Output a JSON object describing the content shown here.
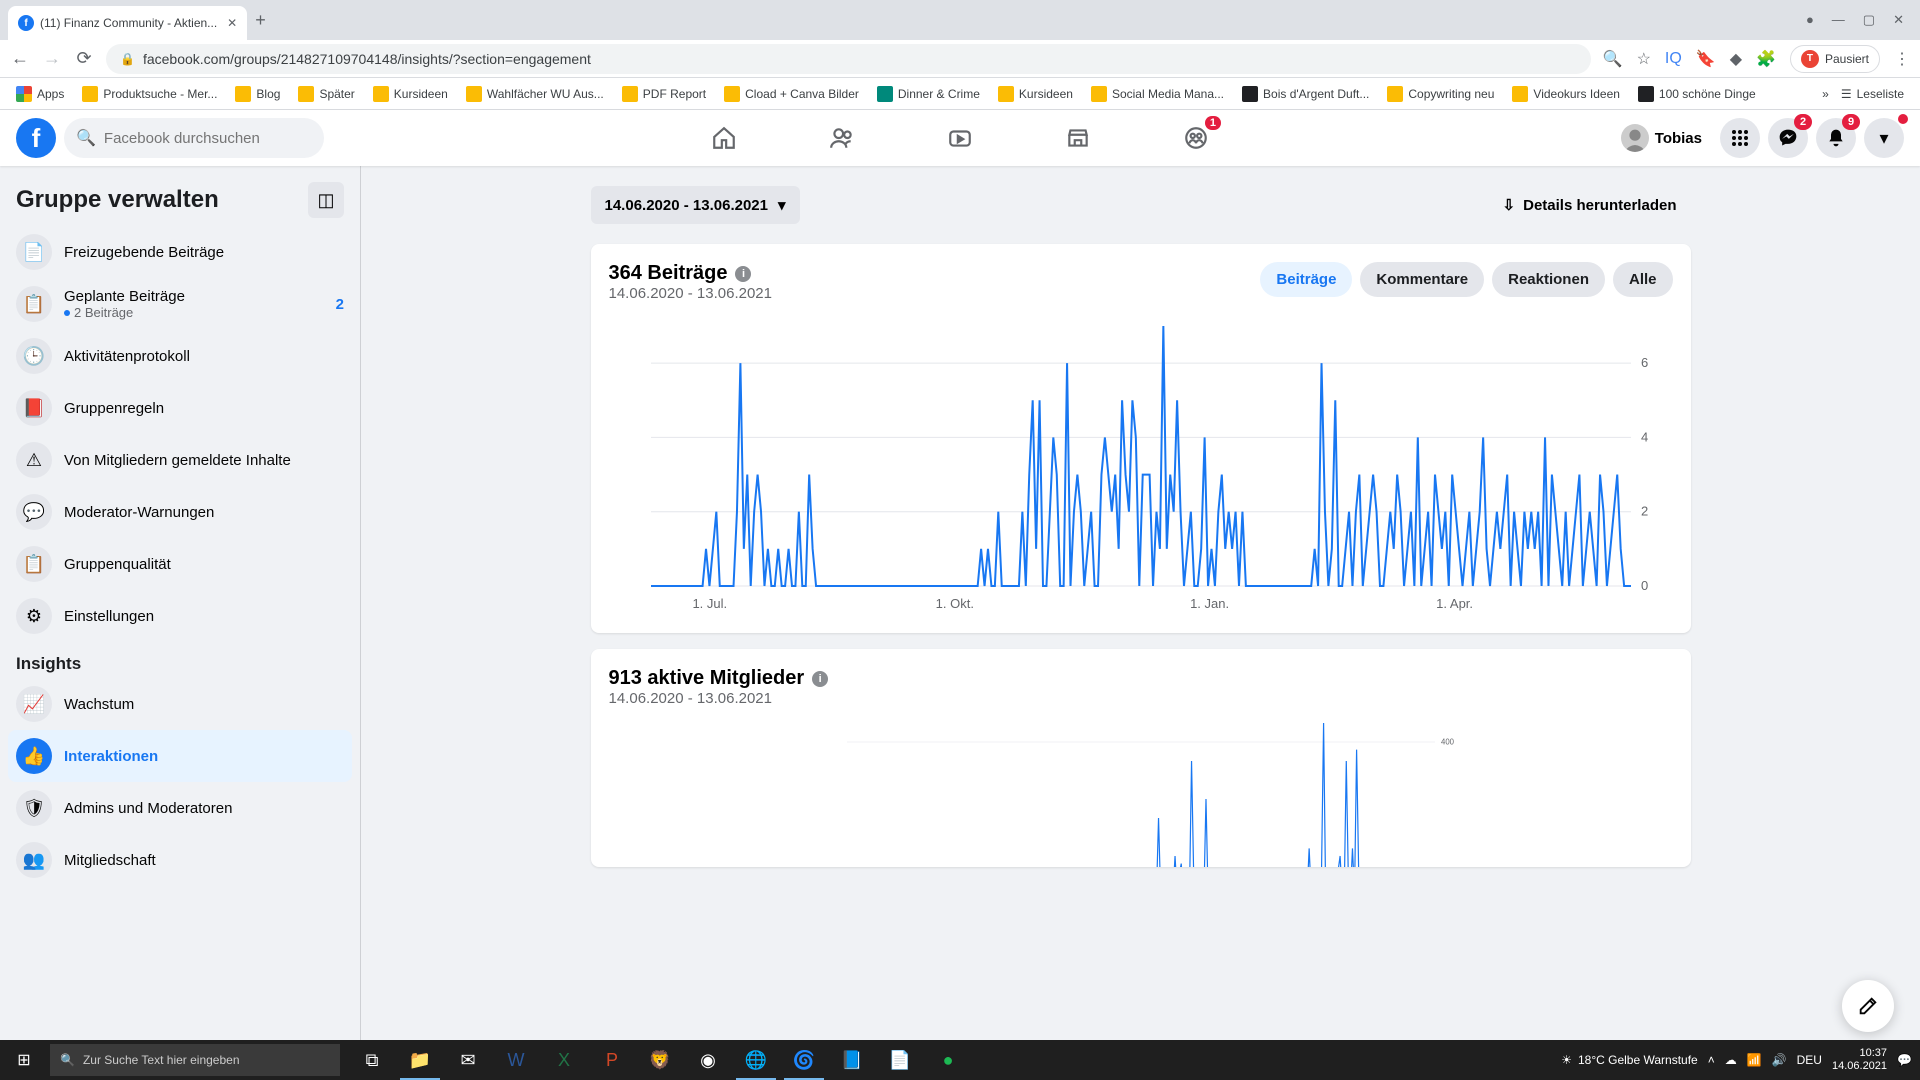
{
  "browser": {
    "tab_title": "(11) Finanz Community - Aktien...",
    "url": "facebook.com/groups/214827109704148/insights/?section=engagement",
    "pause_label": "Pausiert",
    "readlist": "Leseliste",
    "bookmarks": [
      {
        "label": "Apps",
        "icon": "apps"
      },
      {
        "label": "Produktsuche - Mer...",
        "icon": "yellow"
      },
      {
        "label": "Blog",
        "icon": "yellow"
      },
      {
        "label": "Später",
        "icon": "yellow"
      },
      {
        "label": "Kursideen",
        "icon": "yellow"
      },
      {
        "label": "Wahlfächer WU Aus...",
        "icon": "yellow"
      },
      {
        "label": "PDF Report",
        "icon": "yellow"
      },
      {
        "label": "Cload + Canva Bilder",
        "icon": "yellow"
      },
      {
        "label": "Dinner & Crime",
        "icon": "teal"
      },
      {
        "label": "Kursideen",
        "icon": "yellow"
      },
      {
        "label": "Social Media Mana...",
        "icon": "yellow"
      },
      {
        "label": "Bois d'Argent Duft...",
        "icon": "dark"
      },
      {
        "label": "Copywriting neu",
        "icon": "yellow"
      },
      {
        "label": "Videokurs Ideen",
        "icon": "yellow"
      },
      {
        "label": "100 schöne Dinge",
        "icon": "dark"
      }
    ]
  },
  "fb": {
    "search_placeholder": "Facebook durchsuchen",
    "user_name": "Tobias",
    "groups_badge": "1",
    "messenger_badge": "2",
    "notif_badge": "9"
  },
  "sidebar": {
    "title": "Gruppe verwalten",
    "items": [
      {
        "label": "Freizugebende Beiträge",
        "icon": "📄"
      },
      {
        "label": "Geplante Beiträge",
        "icon": "📋",
        "sub": "2 Beiträge",
        "badge": "2"
      },
      {
        "label": "Aktivitätenprotokoll",
        "icon": "🕒"
      },
      {
        "label": "Gruppenregeln",
        "icon": "📕"
      },
      {
        "label": "Von Mitgliedern gemeldete Inhalte",
        "icon": "⚠"
      },
      {
        "label": "Moderator-Warnungen",
        "icon": "💬"
      },
      {
        "label": "Gruppenqualität",
        "icon": "📋"
      },
      {
        "label": "Einstellungen",
        "icon": "⚙"
      }
    ],
    "insights_heading": "Insights",
    "insights": [
      {
        "label": "Wachstum",
        "icon": "📈"
      },
      {
        "label": "Interaktionen",
        "icon": "👍",
        "active": true
      },
      {
        "label": "Admins und Moderatoren",
        "icon": "🛡"
      },
      {
        "label": "Mitgliedschaft",
        "icon": "👥"
      }
    ]
  },
  "main": {
    "date_range": "14.06.2020 - 13.06.2021",
    "download_label": "Details herunterladen",
    "card1_title": "364 Beiträge",
    "card1_sub": "14.06.2020 - 13.06.2021",
    "pills": [
      "Beiträge",
      "Kommentare",
      "Reaktionen",
      "Alle"
    ],
    "card2_title": "913 aktive Mitglieder",
    "card2_sub": "14.06.2020 - 13.06.2021"
  },
  "taskbar": {
    "search_placeholder": "Zur Suche Text hier eingeben",
    "weather": "18°C  Gelbe Warnstufe",
    "lang": "DEU",
    "time": "10:37",
    "date": "14.06.2021"
  },
  "chart_data": [
    {
      "type": "line",
      "title": "364 Beiträge",
      "xlabel": "",
      "ylabel": "",
      "ylim": [
        0,
        7
      ],
      "yticks": [
        0,
        2,
        4,
        6
      ],
      "xticks_major": [
        "1. Jul.",
        "1. Okt.",
        "1. Jan.",
        "1. Apr."
      ],
      "x_start": "2020-06-14",
      "x_end": "2021-06-13",
      "series": [
        {
          "name": "Beiträge",
          "color": "#1877f2",
          "values": [
            0,
            0,
            0,
            0,
            0,
            0,
            0,
            0,
            0,
            0,
            0,
            0,
            0,
            0,
            0,
            0,
            1,
            0,
            1,
            2,
            0,
            0,
            0,
            0,
            0,
            2,
            6,
            1,
            3,
            0,
            2,
            3,
            2,
            0,
            1,
            0,
            0,
            1,
            0,
            0,
            1,
            0,
            0,
            2,
            0,
            0,
            3,
            1,
            0,
            0,
            0,
            0,
            0,
            0,
            0,
            0,
            0,
            0,
            0,
            0,
            0,
            0,
            0,
            0,
            0,
            0,
            0,
            0,
            0,
            0,
            0,
            0,
            0,
            0,
            0,
            0,
            0,
            0,
            0,
            0,
            0,
            0,
            0,
            0,
            0,
            0,
            0,
            0,
            0,
            0,
            0,
            0,
            0,
            0,
            0,
            0,
            1,
            0,
            1,
            0,
            0,
            2,
            0,
            0,
            0,
            0,
            0,
            0,
            2,
            0,
            3,
            5,
            1,
            5,
            0,
            0,
            2,
            4,
            3,
            0,
            0,
            6,
            0,
            2,
            3,
            2,
            0,
            1,
            2,
            0,
            0,
            3,
            4,
            3,
            2,
            3,
            1,
            5,
            3,
            2,
            5,
            4,
            0,
            3,
            3,
            3,
            0,
            2,
            1,
            7,
            1,
            3,
            2,
            5,
            2,
            0,
            1,
            2,
            0,
            0,
            1,
            4,
            0,
            1,
            0,
            2,
            3,
            1,
            2,
            1,
            2,
            0,
            2,
            0,
            0,
            0,
            0,
            0,
            0,
            0,
            0,
            0,
            0,
            0,
            0,
            0,
            0,
            0,
            0,
            0,
            0,
            0,
            0,
            1,
            0,
            6,
            2,
            0,
            1,
            5,
            0,
            0,
            1,
            2,
            0,
            2,
            3,
            0,
            1,
            2,
            3,
            2,
            0,
            0,
            1,
            2,
            1,
            3,
            2,
            0,
            1,
            2,
            0,
            4,
            0,
            1,
            2,
            0,
            3,
            2,
            1,
            2,
            0,
            3,
            2,
            1,
            0,
            1,
            2,
            0,
            1,
            2,
            4,
            1,
            0,
            1,
            2,
            1,
            2,
            3,
            0,
            2,
            1,
            0,
            2,
            1,
            2,
            1,
            2,
            0,
            4,
            0,
            3,
            2,
            1,
            0,
            2,
            0,
            1,
            2,
            3,
            0,
            1,
            2,
            1,
            0,
            3,
            2,
            0,
            1,
            2,
            3,
            1,
            0,
            0,
            0
          ]
        }
      ],
      "n_points": 286
    },
    {
      "type": "line",
      "title": "913 aktive Mitglieder",
      "ylim": [
        0,
        450
      ],
      "yticks": [
        400
      ],
      "x_start": "2020-06-14",
      "x_end": "2021-06-13",
      "series": [
        {
          "name": "Aktive Mitglieder",
          "color": "#1877f2",
          "values": [
            0,
            0,
            0,
            0,
            0,
            0,
            0,
            0,
            0,
            0,
            0,
            0,
            0,
            0,
            0,
            0,
            0,
            0,
            0,
            0,
            0,
            0,
            0,
            0,
            0,
            0,
            0,
            0,
            0,
            0,
            0,
            0,
            0,
            0,
            0,
            0,
            0,
            0,
            0,
            0,
            0,
            0,
            0,
            0,
            0,
            0,
            0,
            0,
            0,
            0,
            0,
            0,
            0,
            0,
            0,
            0,
            0,
            0,
            0,
            0,
            0,
            0,
            0,
            0,
            0,
            0,
            0,
            0,
            0,
            0,
            0,
            0,
            0,
            0,
            0,
            0,
            0,
            0,
            0,
            0,
            0,
            0,
            0,
            0,
            0,
            0,
            0,
            0,
            0,
            0,
            0,
            0,
            0,
            0,
            0,
            0,
            0,
            0,
            0,
            0,
            0,
            0,
            0,
            0,
            0,
            0,
            0,
            0,
            0,
            0,
            0,
            0,
            0,
            0,
            0,
            0,
            0,
            0,
            0,
            0,
            0,
            0,
            0,
            0,
            0,
            0,
            0,
            0,
            0,
            0,
            0,
            0,
            0,
            0,
            0,
            0,
            0,
            0,
            0,
            0,
            0,
            0,
            0,
            0,
            0,
            0,
            0,
            0,
            0,
            0,
            0,
            200,
            0,
            50,
            0,
            0,
            0,
            0,
            0,
            100,
            0,
            50,
            80,
            0,
            0,
            0,
            0,
            350,
            60,
            0,
            0,
            0,
            0,
            0,
            250,
            0,
            40,
            60,
            0,
            0,
            0,
            0,
            0,
            0,
            0,
            0,
            0,
            0,
            0,
            0,
            0,
            0,
            0,
            0,
            0,
            0,
            0,
            0,
            0,
            0,
            0,
            0,
            0,
            0,
            0,
            0,
            0,
            0,
            0,
            0,
            0,
            0,
            0,
            0,
            0,
            0,
            0,
            0,
            40,
            60,
            0,
            0,
            60,
            0,
            120,
            0,
            0,
            40,
            50,
            0,
            60,
            450,
            0,
            40,
            0,
            0,
            0,
            40,
            60,
            100,
            0,
            0,
            350,
            40,
            0,
            120,
            0,
            380,
            60,
            0,
            40,
            0,
            0,
            0,
            0,
            0,
            0,
            0,
            0,
            0,
            0,
            0,
            0,
            0,
            0,
            0,
            0,
            0,
            0,
            0,
            0,
            0,
            0,
            0,
            0,
            0,
            0,
            0,
            0,
            0,
            0,
            0,
            0,
            0,
            0,
            0
          ]
        }
      ],
      "n_points": 286
    }
  ]
}
